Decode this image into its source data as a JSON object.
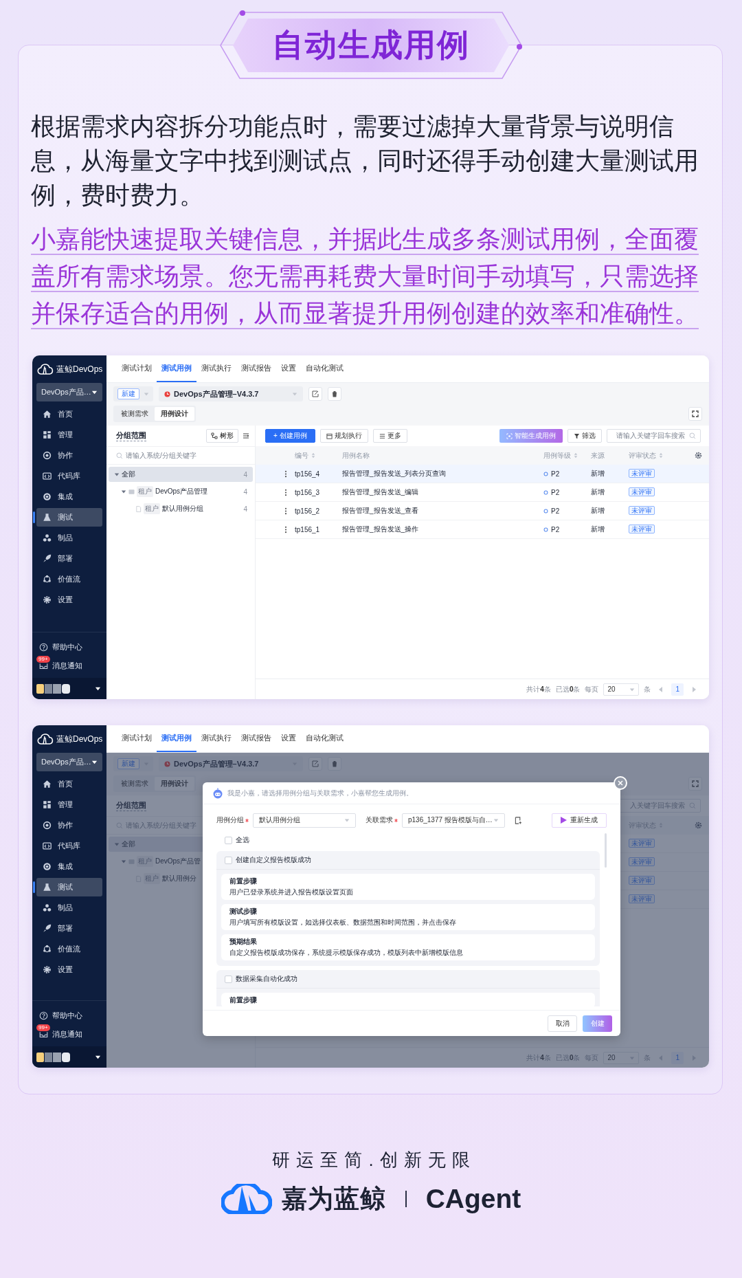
{
  "banner": {
    "title": "自动生成用例"
  },
  "paragraphs": [
    {
      "kind": "plain",
      "text": "根据需求内容拆分功能点时，需要过滤掉大量背景与说明信息，从海量文字中找到测试点，同时还得手动创建大量测试用例，费时费力。"
    },
    {
      "kind": "highlight",
      "text": "小嘉能快速提取关键信息，并据此生成多条测试用例，全面覆盖所有需求场景。您无需再耗费大量时间手动填写，只需选择并保存适合的用例，从而显著提升用例创建的效率和准确性。"
    }
  ],
  "screenshots": [
    {
      "logo": "蓝鲸DevOps",
      "project": "DevOps产品…",
      "nav": [
        {
          "label": "首页",
          "selected": false
        },
        {
          "label": "管理",
          "selected": false
        },
        {
          "label": "协作",
          "selected": false
        },
        {
          "label": "代码库",
          "selected": false
        },
        {
          "label": "集成",
          "selected": false
        },
        {
          "label": "测试",
          "selected": true
        },
        {
          "label": "制品",
          "selected": false
        },
        {
          "label": "部署",
          "selected": false
        },
        {
          "label": "价值流",
          "selected": false
        },
        {
          "label": "设置",
          "selected": false
        }
      ],
      "help": "帮助中心",
      "notify": {
        "label": "消息通知",
        "badge": "99+"
      },
      "tabs": [
        {
          "label": "测试计划",
          "selected": false
        },
        {
          "label": "测试用例",
          "selected": true
        },
        {
          "label": "测试执行",
          "selected": false
        },
        {
          "label": "测试报告",
          "selected": false
        },
        {
          "label": "设置",
          "selected": false
        },
        {
          "label": "自动化测试",
          "selected": false
        }
      ],
      "new_button": "新建",
      "version": "DevOps产品管理–V4.3.7",
      "subtabs": [
        {
          "label": "被测需求",
          "selected": false
        },
        {
          "label": "用例设计",
          "selected": true
        }
      ],
      "groups": {
        "title": "分组范围",
        "tree_button": "树形",
        "search_placeholder": "请输入系统/分组关键字",
        "tree": [
          {
            "label": "全部",
            "count": "4",
            "selected": true,
            "expanded": true,
            "children": [
              {
                "tag": "租户",
                "label": "DevOps产品管理",
                "count": "4",
                "selected": false,
                "expanded": true,
                "children": [
                  {
                    "tag": "租户",
                    "label": "默认用例分组",
                    "count": "4",
                    "selected": false
                  }
                ]
              }
            ]
          }
        ]
      },
      "toolbar": {
        "create": "+ 创建用例",
        "plan": "规划执行",
        "more": "更多",
        "ai": "智能生成用例",
        "filter": "筛选",
        "search_placeholder": "请输入关键字回车搜索"
      },
      "table": {
        "columns": [
          {
            "kind": "id",
            "label": "编号",
            "sortable": true
          },
          {
            "kind": "name",
            "label": "用例名称",
            "sortable": false
          },
          {
            "kind": "level",
            "label": "用例等级",
            "sortable": true
          },
          {
            "kind": "source",
            "label": "来源",
            "sortable": false
          },
          {
            "kind": "review",
            "label": "评审状态",
            "sortable": true
          }
        ],
        "rows": [
          {
            "id": "tp156_4",
            "name": "报告管理_报告发送_列表分页查询",
            "level": "P2",
            "source": "新增",
            "review": "未评审",
            "selected": true
          },
          {
            "id": "tp156_3",
            "name": "报告管理_报告发送_编辑",
            "level": "P2",
            "source": "新增",
            "review": "未评审",
            "selected": false
          },
          {
            "id": "tp156_2",
            "name": "报告管理_报告发送_查看",
            "level": "P2",
            "source": "新增",
            "review": "未评审",
            "selected": false
          },
          {
            "id": "tp156_1",
            "name": "报告管理_报告发送_操作",
            "level": "P2",
            "source": "新增",
            "review": "未评审",
            "selected": false
          }
        ]
      },
      "pagination": {
        "total_count": "共计**4**条",
        "selected_count": "已选**0**条",
        "per_page": "每页",
        "page_size": "20",
        "unit": "条",
        "pages": [
          {
            "label": "1",
            "selected": true
          }
        ]
      }
    },
    {
      "logo": "蓝鲸DevOps",
      "project": "DevOps产品…",
      "nav": [
        {
          "label": "首页",
          "selected": false
        },
        {
          "label": "管理",
          "selected": false
        },
        {
          "label": "协作",
          "selected": false
        },
        {
          "label": "代码库",
          "selected": false
        },
        {
          "label": "集成",
          "selected": false
        },
        {
          "label": "测试",
          "selected": true
        },
        {
          "label": "制品",
          "selected": false
        },
        {
          "label": "部署",
          "selected": false
        },
        {
          "label": "价值流",
          "selected": false
        },
        {
          "label": "设置",
          "selected": false
        }
      ],
      "help": "帮助中心",
      "notify": {
        "label": "消息通知",
        "badge": "99+"
      },
      "tabs": [
        {
          "label": "测试计划",
          "selected": false
        },
        {
          "label": "测试用例",
          "selected": true
        },
        {
          "label": "测试执行",
          "selected": false
        },
        {
          "label": "测试报告",
          "selected": false
        },
        {
          "label": "设置",
          "selected": false
        },
        {
          "label": "自动化测试",
          "selected": false
        }
      ],
      "new_button": "新建",
      "version": "DevOps产品管理–V4.3.7",
      "subtabs": [
        {
          "label": "被测需求",
          "selected": false
        },
        {
          "label": "用例设计",
          "selected": true
        }
      ],
      "groups": {
        "title": "分组范围",
        "search_placeholder": "请输入系统/分组关键字",
        "tree": [
          {
            "label": "全部",
            "selected": true,
            "expanded": true,
            "children": [
              {
                "tag": "租户",
                "label": "DevOps产品管",
                "selected": false,
                "expanded": true,
                "children": [
                  {
                    "tag": "租户",
                    "label": "默认用例分",
                    "selected": false
                  }
                ]
              }
            ]
          }
        ]
      },
      "toolbar": {
        "search_placeholder": "入关键字回车搜索"
      },
      "table": {
        "columns": [
          {
            "kind": "review",
            "label": "评审状态",
            "sortable": true
          }
        ],
        "rows": [
          {
            "review": "未评审"
          },
          {
            "review": "未评审"
          },
          {
            "review": "未评审"
          },
          {
            "review": "未评审"
          }
        ]
      },
      "pagination": {
        "total_count": "共计**4**条",
        "selected_count": "已选**0**条",
        "per_page": "每页",
        "page_size": "20",
        "unit": "条",
        "pages": [
          {
            "label": "1",
            "selected": true
          }
        ]
      },
      "dialog": {
        "message": "我是小嘉，请选择用例分组与关联需求，小嘉帮您生成用例。",
        "fields": [
          {
            "label": "用例分组",
            "required": true,
            "value": "默认用例分组"
          },
          {
            "label": "关联需求",
            "required": true,
            "value": "p136_1377 报告模版与自…"
          }
        ],
        "regenerate": "重新生成",
        "select_all": {
          "label": "全选",
          "checked": false
        },
        "groups": [
          {
            "title": "创建自定义报告模版成功",
            "checked": false,
            "steps": [
              {
                "title": "前置步骤",
                "text": "用户已登录系统并进入报告模版设置页面"
              },
              {
                "title": "测试步骤",
                "text": "用户填写所有模版设置，如选择仪表板、数据范围和时间范围，并点击保存"
              },
              {
                "title": "预期结果",
                "text": "自定义报告模版成功保存，系统提示模版保存成功，模版列表中新增模版信息"
              }
            ]
          },
          {
            "title": "数据采集自动化成功",
            "checked": false,
            "steps": [
              {
                "title": "前置步骤"
              }
            ]
          }
        ],
        "buttons": [
          {
            "kind": "secondary",
            "label": "取消"
          },
          {
            "kind": "primary",
            "label": "创建"
          }
        ]
      }
    }
  ],
  "footer": {
    "slogan": "研运至简.创新无限",
    "brand": "嘉为蓝鲸",
    "product": "CAgent"
  }
}
